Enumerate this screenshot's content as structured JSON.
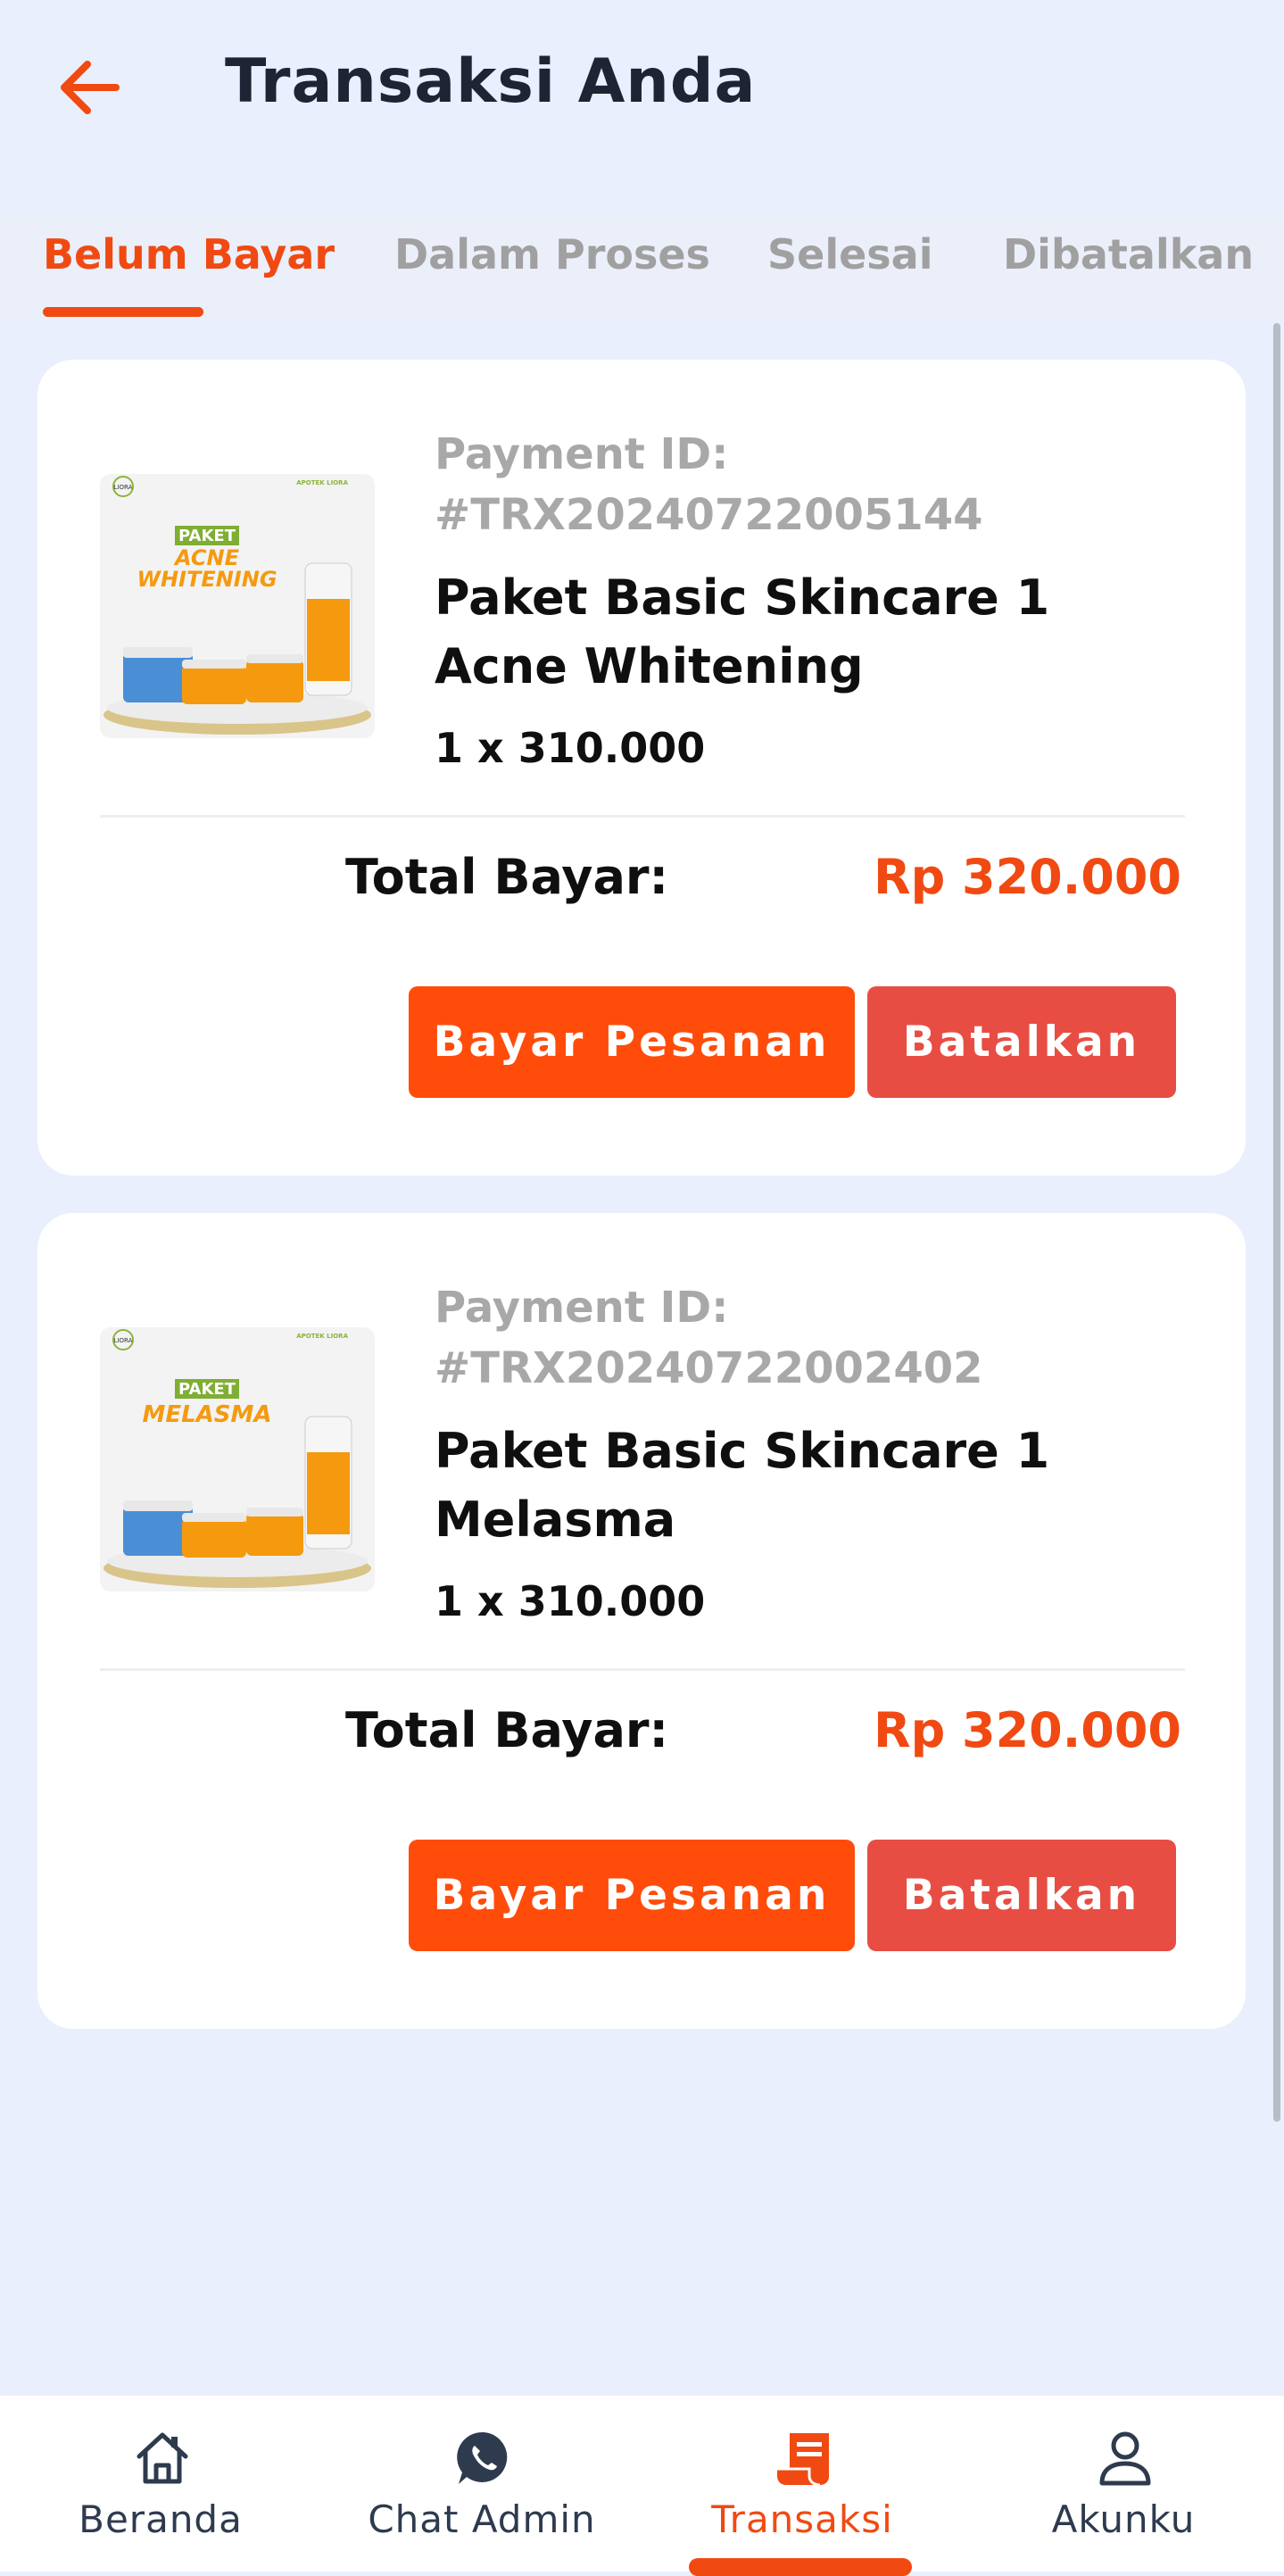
{
  "header": {
    "title": "Transaksi Anda"
  },
  "tabs": [
    {
      "label": "Belum Bayar",
      "active": true
    },
    {
      "label": "Dalam Proses",
      "active": false
    },
    {
      "label": "Selesai",
      "active": false
    },
    {
      "label": "Dibatalkan",
      "active": false
    }
  ],
  "orders": [
    {
      "payment_label": "Payment ID:",
      "payment_id": "#TRX20240722005144",
      "product_name": "Paket Basic Skincare 1 Acne Whitening",
      "quantity": "1 x 310.000",
      "total_label": "Total Bayar:",
      "total": "Rp 320.000",
      "pay_label": "Bayar Pesanan",
      "cancel_label": "Batalkan",
      "image": {
        "brand": "LIORA",
        "brand_sub": "APOTEK LIORA",
        "tag": "PAKET",
        "line1": "ACNE",
        "line2": "WHITENING"
      }
    },
    {
      "payment_label": "Payment ID:",
      "payment_id": "#TRX20240722002402",
      "product_name": "Paket Basic Skincare 1 Melasma",
      "quantity": "1 x 310.000",
      "total_label": "Total Bayar:",
      "total": "Rp 320.000",
      "pay_label": "Bayar Pesanan",
      "cancel_label": "Batalkan",
      "image": {
        "brand": "LIORA",
        "brand_sub": "APOTEK LIORA",
        "tag": "PAKET",
        "line1": "MELASMA",
        "line2": ""
      }
    }
  ],
  "bottom_nav": [
    {
      "label": "Beranda",
      "icon": "home-icon",
      "active": false
    },
    {
      "label": "Chat Admin",
      "icon": "whatsapp-icon",
      "active": false
    },
    {
      "label": "Transaksi",
      "icon": "receipt-icon",
      "active": true
    },
    {
      "label": "Akunku",
      "icon": "user-icon",
      "active": false
    }
  ],
  "colors": {
    "accent": "#f04a12",
    "pay_button": "#ff4c0b",
    "cancel_button": "#e84d43",
    "background": "#e9effc",
    "muted_text": "#a8a8a8"
  }
}
